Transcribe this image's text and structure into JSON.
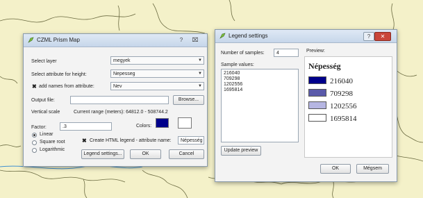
{
  "colors": {
    "map_fill": "#f4f1c9",
    "border_line": "#6a6a40",
    "river": "#3f8fd0",
    "attribute_color": "#00008b",
    "legend_1": "#00008b",
    "legend_2": "#5a5aaa",
    "legend_3": "#b6b6e2",
    "legend_4": "#ffffff"
  },
  "prism_dialog": {
    "title": "CZML Prism Map",
    "help_label": "?",
    "close_label": "⌧",
    "select_layer_label": "Select layer",
    "select_layer_value": "megyek",
    "height_attr_label": "Select attribute for height:",
    "height_attr_value": "Nepesseg",
    "add_names_label": "add names from attribute:",
    "add_names_checked": "✖",
    "names_attr_value": "Nev",
    "output_file_label": "Output file:",
    "output_file_value": "",
    "browse_label": "Browse...",
    "vertical_scale_label": "Vertical scale",
    "current_range_text": "Current range (meters): 64812.0 - 508744.2",
    "factor_label": "Factor:",
    "factor_value": ".3",
    "colors_label": "Colors:",
    "radio_linear": "Linear",
    "radio_sqrt": "Square root",
    "radio_log": "Logarithmic",
    "html_legend_label": "Create HTML legend - attribute name:",
    "html_legend_checked": "✖",
    "legend_attr_value": "Népesség",
    "legend_settings_button": "Legend settings...",
    "ok_button": "OK",
    "cancel_button": "Cancel"
  },
  "legend_dialog": {
    "title": "Legend settings",
    "help_label": "?",
    "close_label": "✕",
    "num_samples_label": "Number of samples:",
    "num_samples_value": "4",
    "sample_values_label": "Sample values:",
    "sample_values": [
      "216040",
      "709298",
      "1202556",
      "1695814"
    ],
    "update_preview_button": "Update preview",
    "preview_label": "Preview:",
    "preview_title": "Népesség",
    "legend_items": [
      "216040",
      "709298",
      "1202556",
      "1695814"
    ],
    "ok_button": "OK",
    "cancel_button": "Mégsem"
  }
}
